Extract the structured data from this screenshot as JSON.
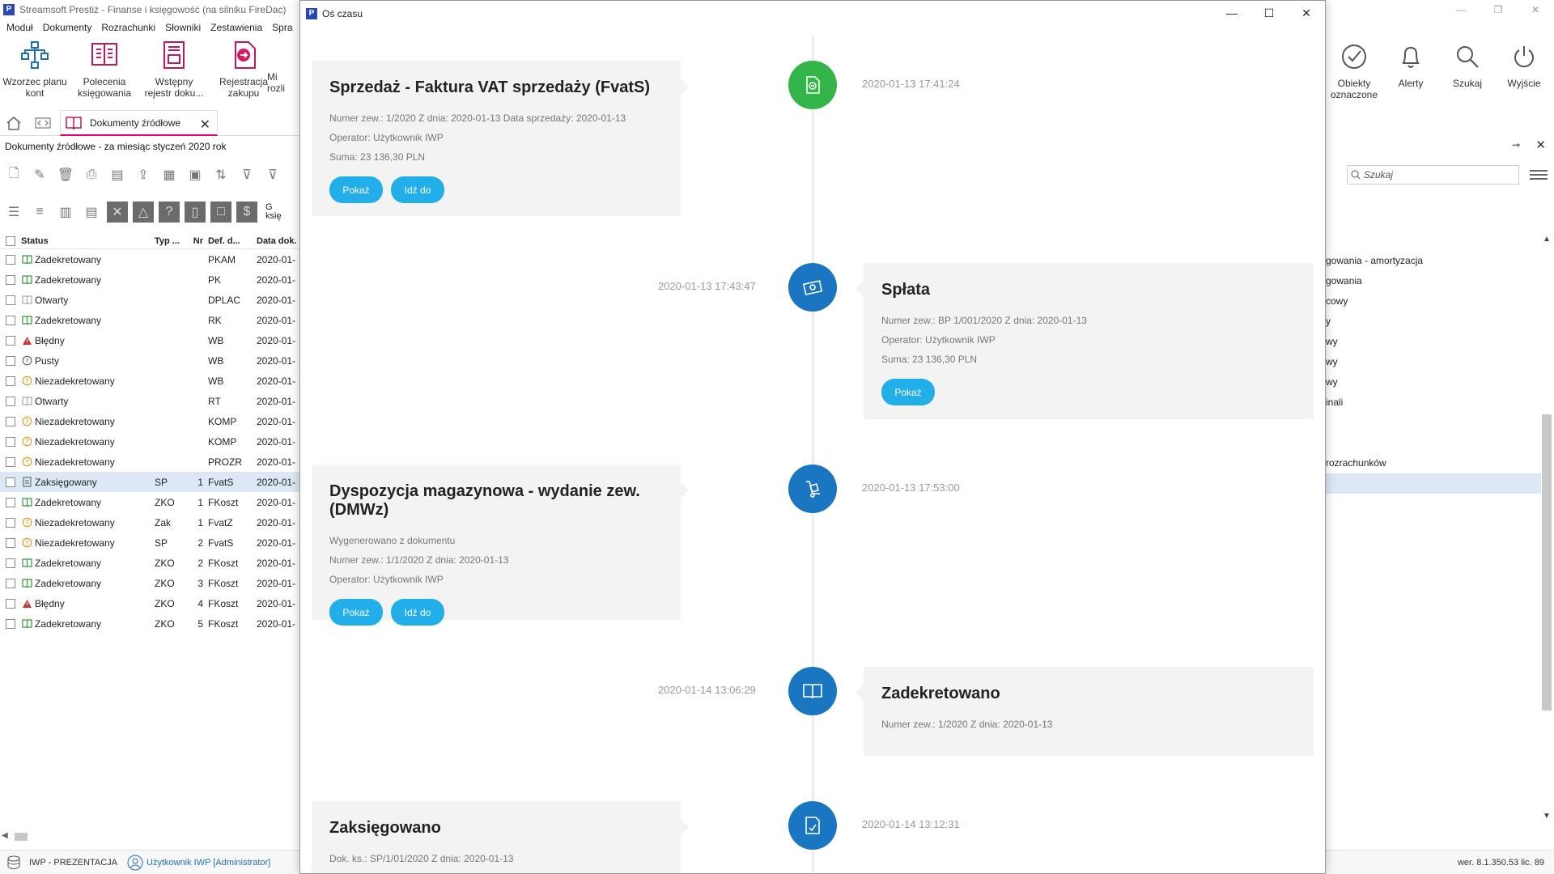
{
  "app": {
    "title": "Streamsoft Prestiż - Finanse i księgowość (na silniku FireDac)",
    "logo": "P",
    "menu": [
      "Moduł",
      "Dokumenty",
      "Rozrachunki",
      "Słowniki",
      "Zestawienia",
      "Spra"
    ],
    "ribbon": [
      {
        "label1": "Wzorzec planu",
        "label2": "kont",
        "icon": "chart-of-accounts-icon"
      },
      {
        "label1": "Polecenia",
        "label2": "księgowania",
        "icon": "posting-orders-icon"
      },
      {
        "label1": "Wstępny",
        "label2": "rejestr doku...",
        "icon": "preliminary-register-icon"
      },
      {
        "label1": "Rejestracja",
        "label2": "zakupu",
        "icon": "purchase-registration-icon"
      },
      {
        "label1": "Mi",
        "label2": "rozli",
        "icon": "settlement-icon"
      }
    ],
    "right_ribbon": [
      {
        "label1": "Obiekty",
        "label2": "oznaczone",
        "icon": "check-circle-icon"
      },
      {
        "label1": "Alerty",
        "label2": "",
        "icon": "bell-icon"
      },
      {
        "label1": "Szukaj",
        "label2": "",
        "icon": "search-icon"
      },
      {
        "label1": "Wyjście",
        "label2": "",
        "icon": "power-icon"
      }
    ],
    "doc_tab": "Dokumenty źródłowe",
    "caption": "Dokumenty źródłowe - za miesiąc styczeń 2020 rok",
    "toolbar_extra_label": "G",
    "toolbar_extra_label2": "księ",
    "search_placeholder": "Szukaj",
    "status_db": "IWP - PREZENTACJA",
    "status_user": "Użytkownik IWP [Administrator]",
    "version": "wer. 8.1.350.53   lic. 89"
  },
  "grid": {
    "headers": {
      "status": "Status",
      "typ": "Typ ...",
      "nr": "Nr",
      "def": "Def. d...",
      "data": "Data dok."
    },
    "rows": [
      {
        "status": "Zadekretowany",
        "icon": "book",
        "typ": "",
        "nr": "",
        "def": "PKAM",
        "data": "2020-01-"
      },
      {
        "status": "Zadekretowany",
        "icon": "book",
        "typ": "",
        "nr": "",
        "def": "PK",
        "data": "2020-01-"
      },
      {
        "status": "Otwarty",
        "icon": "open",
        "typ": "",
        "nr": "",
        "def": "DPLAC",
        "data": "2020-01-"
      },
      {
        "status": "Zadekretowany",
        "icon": "book",
        "typ": "",
        "nr": "",
        "def": "RK",
        "data": "2020-01-"
      },
      {
        "status": "Błędny",
        "icon": "error",
        "typ": "",
        "nr": "",
        "def": "WB",
        "data": "2020-01-"
      },
      {
        "status": "Pusty",
        "icon": "empty",
        "typ": "",
        "nr": "",
        "def": "WB",
        "data": "2020-01-"
      },
      {
        "status": "Niezadekretowany",
        "icon": "warn",
        "typ": "",
        "nr": "",
        "def": "WB",
        "data": "2020-01-"
      },
      {
        "status": "Otwarty",
        "icon": "open",
        "typ": "",
        "nr": "",
        "def": "RT",
        "data": "2020-01-"
      },
      {
        "status": "Niezadekretowany",
        "icon": "warn",
        "typ": "",
        "nr": "",
        "def": "KOMP",
        "data": "2020-01-"
      },
      {
        "status": "Niezadekretowany",
        "icon": "warn",
        "typ": "",
        "nr": "",
        "def": "KOMP",
        "data": "2020-01-"
      },
      {
        "status": "Niezadekretowany",
        "icon": "warn",
        "typ": "",
        "nr": "",
        "def": "PROZR",
        "data": "2020-01-"
      },
      {
        "status": "Zaksięgowany",
        "icon": "posted",
        "typ": "SP",
        "nr": "1",
        "def": "FvatS",
        "data": "2020-01-",
        "selected": true
      },
      {
        "status": "Zadekretowany",
        "icon": "book",
        "typ": "ZKO",
        "nr": "1",
        "def": "FKoszt",
        "data": "2020-01-"
      },
      {
        "status": "Niezadekretowany",
        "icon": "warn",
        "typ": "Zak",
        "nr": "1",
        "def": "FvatZ",
        "data": "2020-01-"
      },
      {
        "status": "Niezadekretowany",
        "icon": "warn",
        "typ": "SP",
        "nr": "2",
        "def": "FvatS",
        "data": "2020-01-"
      },
      {
        "status": "Zadekretowany",
        "icon": "book",
        "typ": "ZKO",
        "nr": "2",
        "def": "FKoszt",
        "data": "2020-01-"
      },
      {
        "status": "Zadekretowany",
        "icon": "book",
        "typ": "ZKO",
        "nr": "3",
        "def": "FKoszt",
        "data": "2020-01-"
      },
      {
        "status": "Błędny",
        "icon": "error",
        "typ": "ZKO",
        "nr": "4",
        "def": "FKoszt",
        "data": "2020-01-"
      },
      {
        "status": "Zadekretowany",
        "icon": "book",
        "typ": "ZKO",
        "nr": "5",
        "def": "FKoszt",
        "data": "2020-01-"
      }
    ]
  },
  "right_list": [
    "gowania - amortyzacja",
    "gowania",
    "cowy",
    "y",
    "wy",
    "wy",
    "wy",
    "inali",
    "",
    "",
    "rozrachunków",
    ""
  ],
  "modal": {
    "title": "Oś czasu",
    "logo": "P",
    "events": [
      {
        "title": "Sprzedaż - Faktura VAT sprzedaży (FvatS)",
        "lines": [
          "Numer zew.: 1/2020 Z dnia: 2020-01-13 Data sprzedaży: 2020-01-13",
          "Operator: Użytkownik IWP",
          "Suma: 23 136,30 PLN"
        ],
        "timestamp": "2020-01-13 17:41:24",
        "buttons": [
          "Pokaż",
          "Idź do"
        ],
        "node_color": "#34b54a"
      },
      {
        "title": "Spłata",
        "lines": [
          "Numer zew.: BP 1/001/2020 Z dnia: 2020-01-13",
          "Operator: Użytkownik IWP",
          "Suma: 23 136,30 PLN"
        ],
        "timestamp": "2020-01-13 17:43:47",
        "buttons": [
          "Pokaż"
        ],
        "node_color": "#1a76c0"
      },
      {
        "title": "Dyspozycja magazynowa - wydanie zew. (DMWz)",
        "lines": [
          "Wygenerowano z dokumentu",
          "Numer zew.: 1/1/2020 Z dnia: 2020-01-13",
          "Operator: Użytkownik IWP"
        ],
        "timestamp": "2020-01-13 17:53:00",
        "buttons": [
          "Pokaż",
          "Idź do"
        ],
        "node_color": "#1a76c0"
      },
      {
        "title": "Zadekretowano",
        "lines": [
          "Numer zew.: 1/2020 Z dnia: 2020-01-13"
        ],
        "timestamp": "2020-01-14 13:06:29",
        "buttons": [],
        "node_color": "#1a76c0"
      },
      {
        "title": "Zaksięgowano",
        "lines": [
          "Dok. ks.: SP/1/01/2020 Z dnia: 2020-01-13"
        ],
        "timestamp": "2020-01-14 13:12:31",
        "buttons": [],
        "node_color": "#1a76c0"
      }
    ]
  }
}
